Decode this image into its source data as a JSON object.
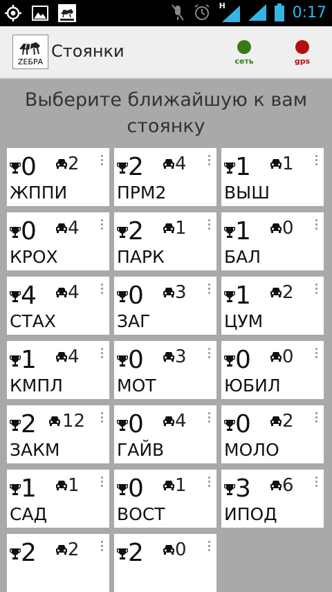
{
  "statusbar": {
    "time": "0:17",
    "signal_letter": "H",
    "time_color": "#33b5e5",
    "icons": [
      "gps-icon",
      "image-icon",
      "zebra-app-icon",
      "mute-icon",
      "alarm-icon",
      "signal-h-icon",
      "signal-icon",
      "battery-icon"
    ]
  },
  "actionbar": {
    "title": "Стоянки",
    "logo_text": "ZEБРА",
    "indicators": [
      {
        "label": "сеть",
        "color": "#3a7a16"
      },
      {
        "label": "gps",
        "color": "#b01010"
      }
    ]
  },
  "heading": "Выберите ближайшую к вам стоянку",
  "tiles": [
    {
      "rank": "0",
      "cars": "2",
      "name": "ЖППИ"
    },
    {
      "rank": "2",
      "cars": "4",
      "name": "ПРМ2"
    },
    {
      "rank": "1",
      "cars": "1",
      "name": "ВЫШ"
    },
    {
      "rank": "0",
      "cars": "4",
      "name": "КРОХ"
    },
    {
      "rank": "2",
      "cars": "1",
      "name": "ПАРК"
    },
    {
      "rank": "1",
      "cars": "0",
      "name": "БАЛ"
    },
    {
      "rank": "4",
      "cars": "4",
      "name": "СТАХ"
    },
    {
      "rank": "0",
      "cars": "3",
      "name": "ЗАГ"
    },
    {
      "rank": "1",
      "cars": "2",
      "name": "ЦУМ"
    },
    {
      "rank": "1",
      "cars": "4",
      "name": "КМПЛ"
    },
    {
      "rank": "0",
      "cars": "3",
      "name": "МОТ"
    },
    {
      "rank": "0",
      "cars": "0",
      "name": "ЮБИЛ"
    },
    {
      "rank": "2",
      "cars": "12",
      "name": "ЗАКМ"
    },
    {
      "rank": "0",
      "cars": "4",
      "name": "ГАЙВ"
    },
    {
      "rank": "0",
      "cars": "2",
      "name": "МОЛО"
    },
    {
      "rank": "1",
      "cars": "1",
      "name": "САД"
    },
    {
      "rank": "0",
      "cars": "1",
      "name": "ВОСТ"
    },
    {
      "rank": "3",
      "cars": "6",
      "name": "ИПОД"
    },
    {
      "rank": "2",
      "cars": "2",
      "name": ""
    },
    {
      "rank": "2",
      "cars": "0",
      "name": ""
    }
  ]
}
